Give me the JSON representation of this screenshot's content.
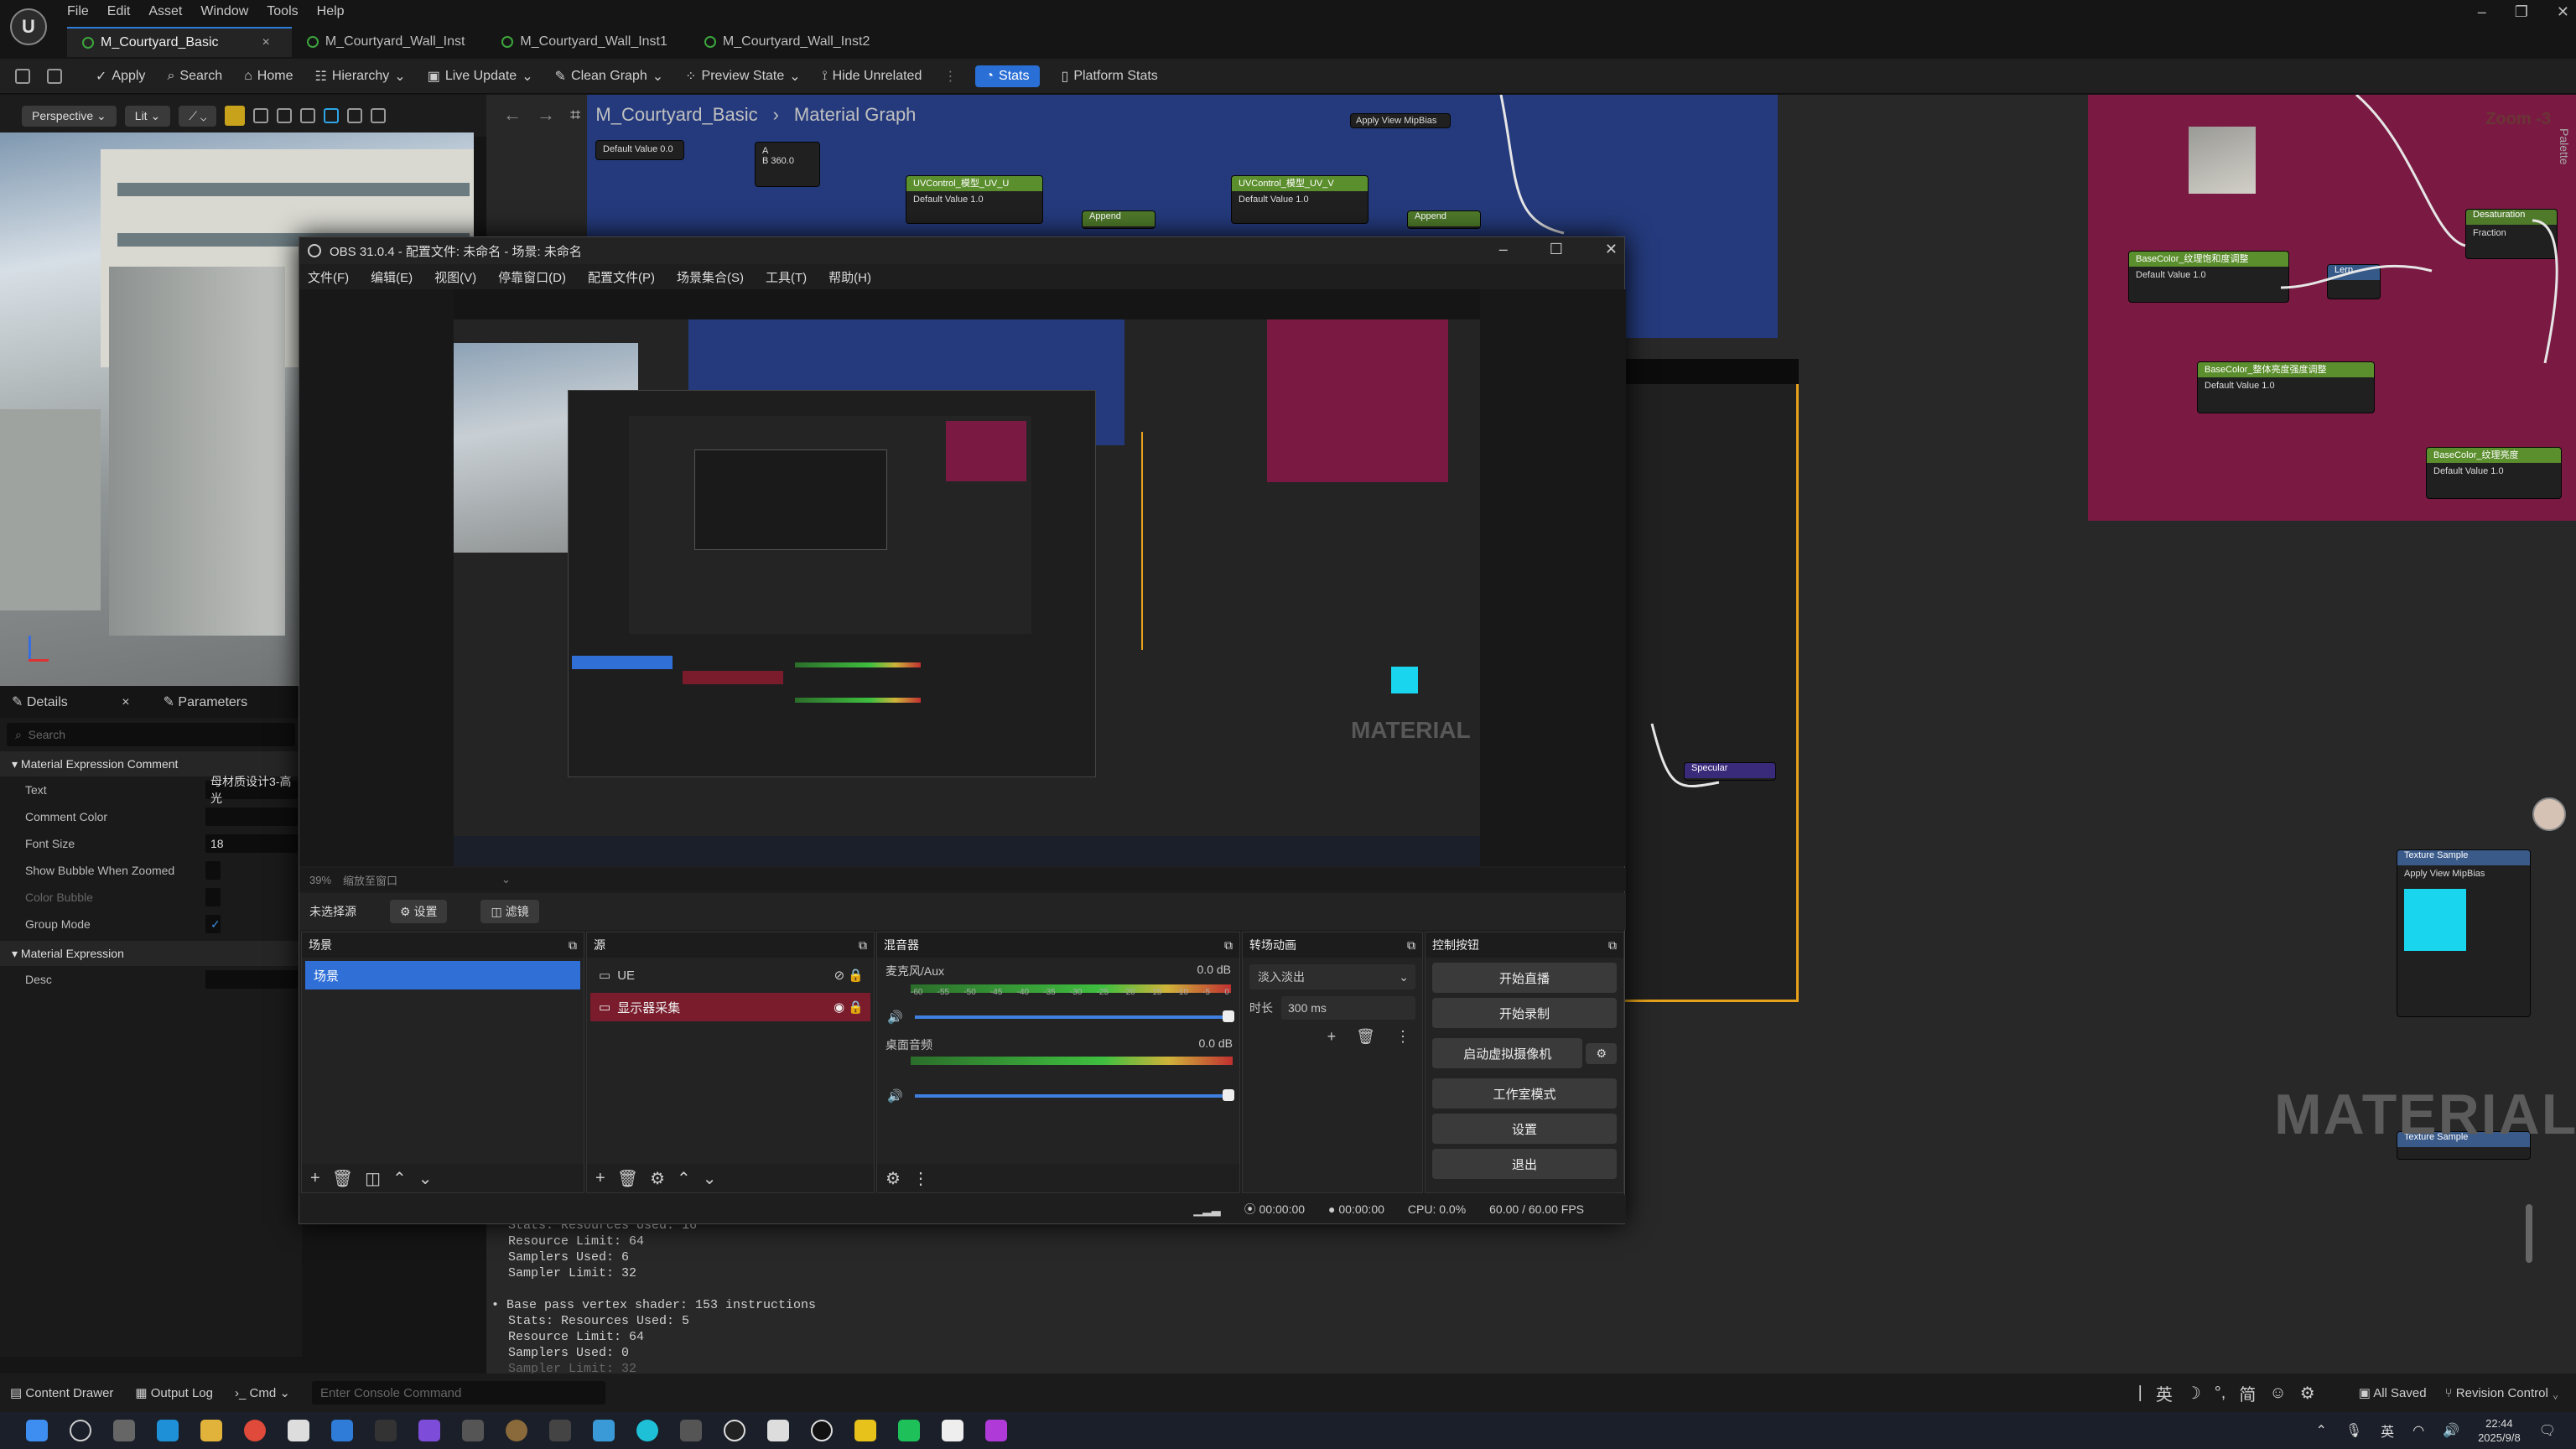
{
  "app": {
    "menu": [
      "File",
      "Edit",
      "Asset",
      "Window",
      "Tools",
      "Help"
    ],
    "tabs": [
      "M_Courtyard_Basic",
      "M_Courtyard_Wall_Inst",
      "M_Courtyard_Wall_Inst1",
      "M_Courtyard_Wall_Inst2"
    ]
  },
  "toolbar": {
    "apply": "Apply",
    "search": "Search",
    "home": "Home",
    "hierarchy": "Hierarchy",
    "live_update": "Live Update",
    "clean_graph": "Clean Graph",
    "preview_state": "Preview State",
    "hide_unrelated": "Hide Unrelated",
    "stats": "Stats",
    "platform_stats": "Platform Stats"
  },
  "viewport": {
    "perspective": "Perspective",
    "lit": "Lit"
  },
  "breadcrumb": {
    "root": "M_Courtyard_Basic",
    "current": "Material Graph"
  },
  "details": {
    "tab_details": "Details",
    "tab_params": "Parameters",
    "search_placeholder": "Search",
    "section1": "Material Expression Comment",
    "rows": [
      {
        "label": "Text",
        "value": "母材质设计3-高光"
      },
      {
        "label": "Comment Color",
        "value": ""
      },
      {
        "label": "Font Size",
        "value": "18"
      },
      {
        "label": "Show Bubble When Zoomed",
        "value": ""
      },
      {
        "label": "Color Bubble",
        "value": ""
      },
      {
        "label": "Group Mode",
        "value": "✓"
      }
    ],
    "section2": "Material Expression",
    "desc_label": "Desc"
  },
  "graph": {
    "zoom": "Zoom -3",
    "palette": "Palette",
    "watermark": "MATERIAL",
    "nodes": {
      "default_value_a": "Default Value",
      "uv_node1": "UVControl_模型_UV_U",
      "uv_node2": "UVControl_模型_UV_V",
      "append": "Append",
      "basecolor1": "BaseColor_纹理饱和度调整",
      "basecolor2": "BaseColor_整体亮度强度调整",
      "basecolor3": "BaseColor_纹理亮度",
      "desaturation": "Desaturation",
      "fraction": "Fraction",
      "lerp": "Lerp",
      "specular": "Specular",
      "texture_sample": "Texture Sample",
      "apply_view_mipbias": "Apply View MipBias",
      "val1": "1.0",
      "val0": "0.0",
      "val360": "360.0"
    }
  },
  "obs": {
    "title": "OBS 31.0.4 - 配置文件: 未命名 - 场景: 未命名",
    "menu": [
      "文件(F)",
      "编辑(E)",
      "视图(V)",
      "停靠窗口(D)",
      "配置文件(P)",
      "场景集合(S)",
      "工具(T)",
      "帮助(H)"
    ],
    "zoom": "39%",
    "zoom_label": "缩放至窗口",
    "no_source": "未选择源",
    "settings_btn": "设置",
    "filters_btn": "滤镜",
    "scenes_title": "场景",
    "scene_item": "场景",
    "sources_title": "源",
    "source_ue": "UE",
    "source_display": "显示器采集",
    "mixer_title": "混音器",
    "mic_name": "麦克风/Aux",
    "mic_db": "0.0 dB",
    "desktop_name": "桌面音频",
    "desktop_db": "0.0 dB",
    "meter_ticks": [
      "-60",
      "-55",
      "-50",
      "-45",
      "-40",
      "-35",
      "-30",
      "-25",
      "-20",
      "-15",
      "-10",
      "-5",
      "0"
    ],
    "transitions_title": "转场动画",
    "transition": "淡入淡出",
    "duration_label": "时长",
    "duration": "300 ms",
    "controls_title": "控制按钮",
    "controls": [
      "开始直播",
      "开始录制",
      "启动虚拟摄像机",
      "工作室模式",
      "设置",
      "退出"
    ],
    "stream_time": "00:00:00",
    "rec_time": "00:00:00",
    "cpu": "CPU: 0.0%",
    "fps": "60.00 / 60.00 FPS"
  },
  "log": [
    "Stats: Resources Used: 16",
    "Resource Limit: 64",
    "Samplers Used: 6",
    "Sampler Limit: 32",
    "",
    "• Base pass vertex shader: 153 instructions",
    "Stats: Resources Used: 5",
    "Resource Limit: 64",
    "Samplers Used: 0",
    "Sampler Limit: 32"
  ],
  "bottom": {
    "content_drawer": "Content Drawer",
    "output_log": "Output Log",
    "cmd": "Cmd",
    "console_placeholder": "Enter Console Command",
    "all_saved": "All Saved",
    "revision": "Revision Control",
    "ime": [
      "英",
      "简"
    ]
  },
  "taskbar": {
    "time": "22:44",
    "date": "2025/9/8"
  },
  "colors": {
    "accent": "#2f7bd8",
    "obs_red": "#7a1c2c",
    "graph_blue": "#243a7c",
    "graph_crimson": "#7a1a43",
    "orange_frame": "#e6a21a"
  }
}
